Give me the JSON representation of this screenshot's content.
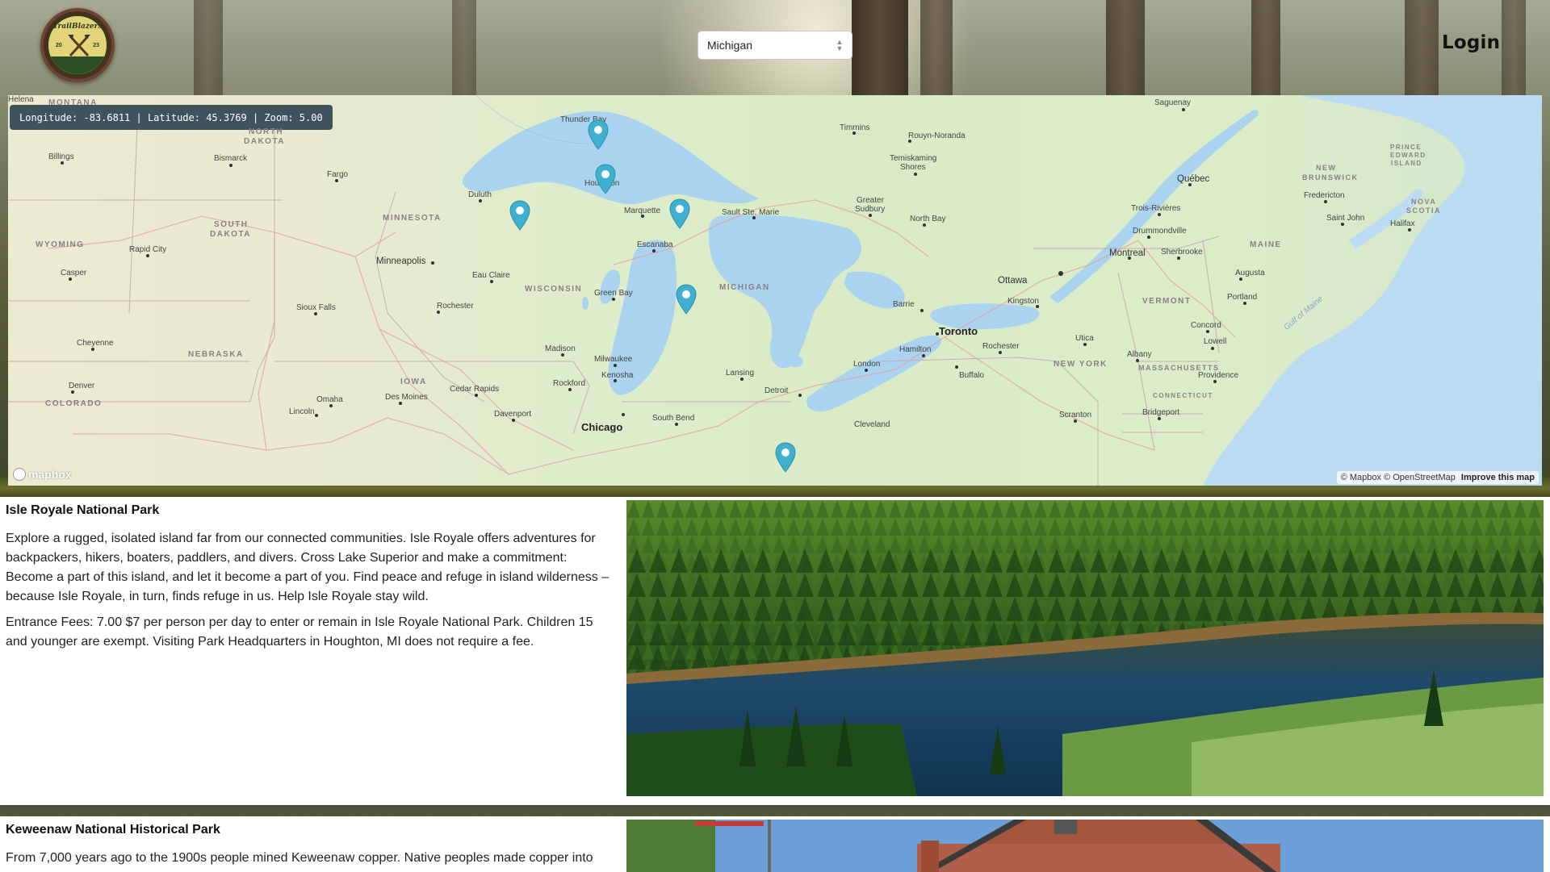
{
  "header": {
    "logo_text": "TrailBlazers",
    "logo_year_left": "20",
    "logo_year_right": "23",
    "state_select_value": "Michigan",
    "login_label": "Login"
  },
  "map": {
    "coordinates_readout": "Longitude: -83.6811 | Latitude: 45.3769 | Zoom: 5.00",
    "longitude": -83.6811,
    "latitude": 45.3769,
    "zoom": 5.0,
    "attribution_mapbox": "© Mapbox",
    "attribution_osm": "© OpenStreetMap",
    "improve_label": "Improve this map",
    "mapbox_logo_text": "mapbox",
    "marker_icon": "location-pin-icon",
    "marker_color": "#3fb1ce",
    "labels": {
      "helena": "Helena",
      "montana": "MONTANA",
      "north_dakota_1": "NORTH",
      "north_dakota_2": "DAKOTA",
      "billings": "Billings",
      "bismarck": "Bismarck",
      "fargo": "Fargo",
      "minnesota": "MINNESOTA",
      "duluth": "Duluth",
      "wyoming": "WYOMING",
      "south_dakota_1": "SOUTH",
      "south_dakota_2": "DAKOTA",
      "rapid_city": "Rapid City",
      "casper": "Casper",
      "minneapolis": "Minneapolis",
      "eau_claire": "Eau Claire",
      "wisconsin": "WISCONSIN",
      "sioux_falls": "Sioux Falls",
      "rochester_mn": "Rochester",
      "cheyenne": "Cheyenne",
      "nebraska": "NEBRASKA",
      "denver": "Denver",
      "colorado": "COLORADO",
      "omaha": "Omaha",
      "lincoln": "Lincoln",
      "iowa": "IOWA",
      "des_moines": "Des Moines",
      "cedar_rapids": "Cedar Rapids",
      "davenport": "Davenport",
      "rockford": "Rockford",
      "madison": "Madison",
      "milwaukee": "Milwaukee",
      "kenosha": "Kenosha",
      "chicago": "Chicago",
      "south_bend": "South Bend",
      "green_bay": "Green Bay",
      "thunder_bay": "Thunder Bay",
      "houghton": "Houghton",
      "marquette": "Marquette",
      "escanaba": "Escanaba",
      "michigan": "MICHIGAN",
      "lansing": "Lansing",
      "detroit": "Detroit",
      "cleveland": "Cleveland",
      "sault_ste_marie": "Sault Ste. Marie",
      "timmins": "Timmins",
      "rouyn_noranda": "Rouyn-Noranda",
      "temiskaming_1": "Temiskaming",
      "temiskaming_2": "Shores",
      "greater_sudbury_1": "Greater",
      "greater_sudbury_2": "Sudbury",
      "north_bay": "North Bay",
      "ottawa": "Ottawa",
      "barrie": "Barrie",
      "toronto": "Toronto",
      "hamilton": "Hamilton",
      "london": "London",
      "kingston": "Kingston",
      "rochester_ny": "Rochester",
      "buffalo": "Buffalo",
      "utica": "Utica",
      "albany": "Albany",
      "new_york": "NEW YORK",
      "scranton": "Scranton",
      "bridgeport": "Bridgeport",
      "saguenay": "Saguenay",
      "quebec": "Québec",
      "trois_rivieres": "Trois-Rivières",
      "drummondville": "Drummondville",
      "montreal": "Montreal",
      "sherbrooke": "Sherbrooke",
      "maine": "MAINE",
      "vermont": "VERMONT",
      "augusta": "Augusta",
      "portland": "Portland",
      "concord": "Concord",
      "lowell": "Lowell",
      "massachusetts": "MASSACHUSETTS",
      "providence": "Providence",
      "connecticut": "CONNECTICUT",
      "new_brunswick_1": "NEW",
      "new_brunswick_2": "BRUNSWICK",
      "fredericton": "Fredericton",
      "saint_john": "Saint John",
      "pei_1": "PRINCE",
      "pei_2": "EDWARD",
      "pei_3": "ISLAND",
      "nova_scotia_1": "NOVA",
      "nova_scotia_2": "SCOTIA",
      "halifax": "Halifax",
      "gulf_of_maine": "Gulf of Maine"
    }
  },
  "parks": [
    {
      "title": "Isle Royale National Park",
      "description": "Explore a rugged, isolated island far from our connected communities. Isle Royale offers adventures for backpackers, hikers, boaters, paddlers, and divers. Cross Lake Superior and make a commitment: Become a part of this island, and let it become a part of you. Find peace and refuge in island wilderness – because Isle Royale, in turn, finds refuge in us. Help Isle Royale stay wild.",
      "fees": "Entrance Fees: 7.00 $7 per person per day to enter or remain in Isle Royale National Park. Children 15 and younger are exempt. Visiting Park Headquarters in Houghton, MI does not require a fee."
    },
    {
      "title": "Keweenaw National Historical Park",
      "description": "From 7,000 years ago to the 1900s people mined Keweenaw copper. Native peoples made copper into",
      "fees": ""
    }
  ]
}
